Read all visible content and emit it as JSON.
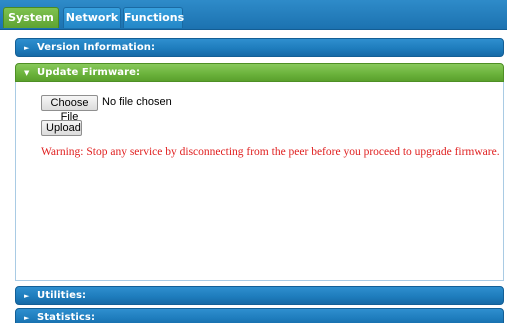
{
  "tabs": {
    "system": "System",
    "network": "Network",
    "functions": "Functions"
  },
  "sections": {
    "version": "Version Information:",
    "firmware": "Update Firmware:",
    "utilities": "Utilities:",
    "statistics": "Statistics:"
  },
  "firmware": {
    "choose_file_label": "Choose File",
    "file_status": "No file chosen",
    "upload_label": "Upload",
    "warning": "Warning: Stop any service by disconnecting from the peer before you proceed to upgrade firmware."
  },
  "icons": {
    "collapsed": "chevron-right-icon",
    "expanded": "chevron-down-icon"
  },
  "colors": {
    "active_tab": "#6cb43d",
    "header_blue": "#1e7dbd",
    "header_green": "#6cb43d",
    "warning": "#e02020"
  }
}
